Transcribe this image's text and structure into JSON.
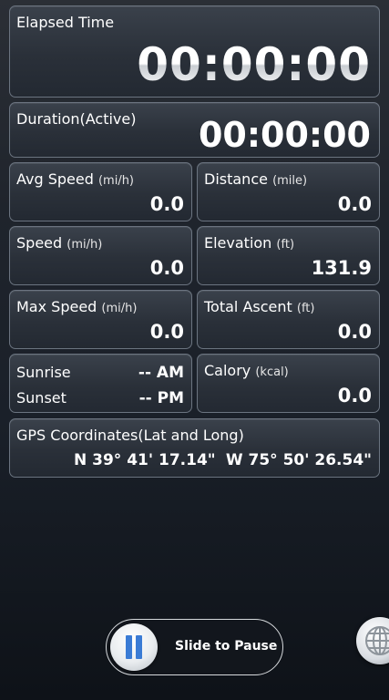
{
  "elapsed": {
    "label": "Elapsed Time",
    "value": "00:00:00"
  },
  "duration": {
    "label": "Duration(Active)",
    "value": "00:00:00"
  },
  "avg_speed": {
    "label": "Avg Speed",
    "unit": "(mi/h)",
    "value": "0.0"
  },
  "distance": {
    "label": "Distance",
    "unit": "(mile)",
    "value": "0.0"
  },
  "speed": {
    "label": "Speed",
    "unit": "(mi/h)",
    "value": "0.0"
  },
  "elevation": {
    "label": "Elevation",
    "unit": "(ft)",
    "value": "131.9"
  },
  "max_speed": {
    "label": "Max Speed",
    "unit": "(mi/h)",
    "value": "0.0"
  },
  "total_ascent": {
    "label": "Total Ascent",
    "unit": "(ft)",
    "value": "0.0"
  },
  "sun": {
    "sunrise_label": "Sunrise",
    "sunrise_value": "-- AM",
    "sunset_label": "Sunset",
    "sunset_value": "-- PM"
  },
  "calory": {
    "label": "Calory",
    "unit": "(kcal)",
    "value": "0.0"
  },
  "gps": {
    "label": "GPS Coordinates(Lat and Long)",
    "lat": "N 39° 41' 17.14\"",
    "long": "W 75° 50' 26.54\""
  },
  "slider": {
    "label": "Slide to Pause",
    "icon": "pause-icon",
    "accent": "#3a7bd5"
  },
  "globe": {
    "icon": "globe-icon"
  }
}
